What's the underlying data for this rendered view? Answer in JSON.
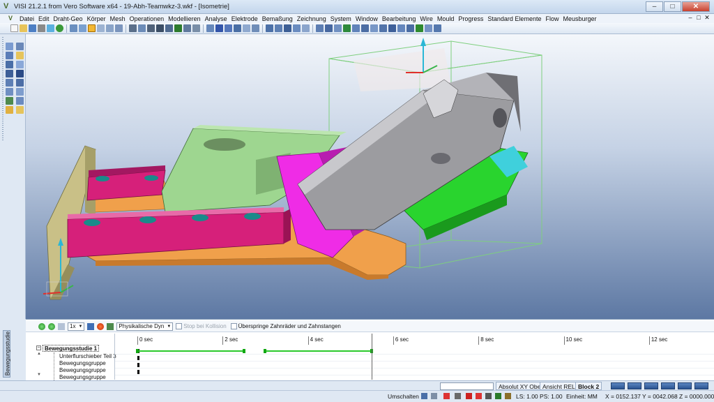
{
  "window": {
    "title": "VISI 21.2.1 from Vero Software x64 - 19-Abh-Teamwkz-3.wkf - [Isometrie]",
    "minimize": "–",
    "maximize": "□",
    "close": "✕"
  },
  "menu": [
    "Datei",
    "Edit",
    "Draht-Geo",
    "Körper",
    "Mesh",
    "Operationen",
    "Modellieren",
    "Analyse",
    "Elektrode",
    "Bemaßung",
    "Zeichnung",
    "System",
    "Window",
    "Bearbeitung",
    "Wire",
    "Mould",
    "Progress",
    "Standard Elemente",
    "Flow",
    "Meusburger"
  ],
  "mdi_controls": [
    "–",
    "□",
    "✕"
  ],
  "motion": {
    "side_tab": "Bewegungsstudie",
    "speed": "1x",
    "mode": "Physikalische Dyn",
    "stop_collision": "Stop bei Kollision",
    "skip_gears": "Überspringe Zahnräder und Zahnstangen",
    "tree_root": "Bewegungsstudie 1",
    "tree_expander": "−",
    "tree_children": [
      "Unterflurschieber Teil 3",
      "Bewegungsgruppe",
      "Bewegungsgruppe",
      "Bewegungsgruppe"
    ],
    "ticks": [
      "0 sec",
      "2 sec",
      "4 sec",
      "6 sec",
      "8 sec",
      "10 sec",
      "12 sec"
    ],
    "tracks": [
      {
        "segments": [
          [
            0,
            2.5
          ],
          [
            3.0,
            5.5
          ]
        ]
      },
      {
        "segments": []
      },
      {
        "segments": []
      },
      {
        "segments": []
      }
    ],
    "cursor_sec": 5.5,
    "max_sec": 13.5
  },
  "status": {
    "absolute": "Absolut XY Ober",
    "view": "Ansicht REL",
    "block": "Block 2",
    "umschalten": "Umschalten",
    "ls_ps": "LS: 1.00 PS: 1.00",
    "units": "Einheit: MM",
    "coords": "X = 0152.137 Y = 0042.068 Z = 0000.000"
  },
  "colors": {
    "part_body": "#9c9ca0",
    "bracket": "#d6207a",
    "magenta_part": "#ef2ce6",
    "light_green_plate": "#9ed690",
    "green_part": "#29d42e",
    "orange_base": "#f0a04b",
    "khaki_plate": "#c9c087",
    "cyan_part": "#3fd0dc",
    "bounding_box": "#7ecf7e"
  }
}
